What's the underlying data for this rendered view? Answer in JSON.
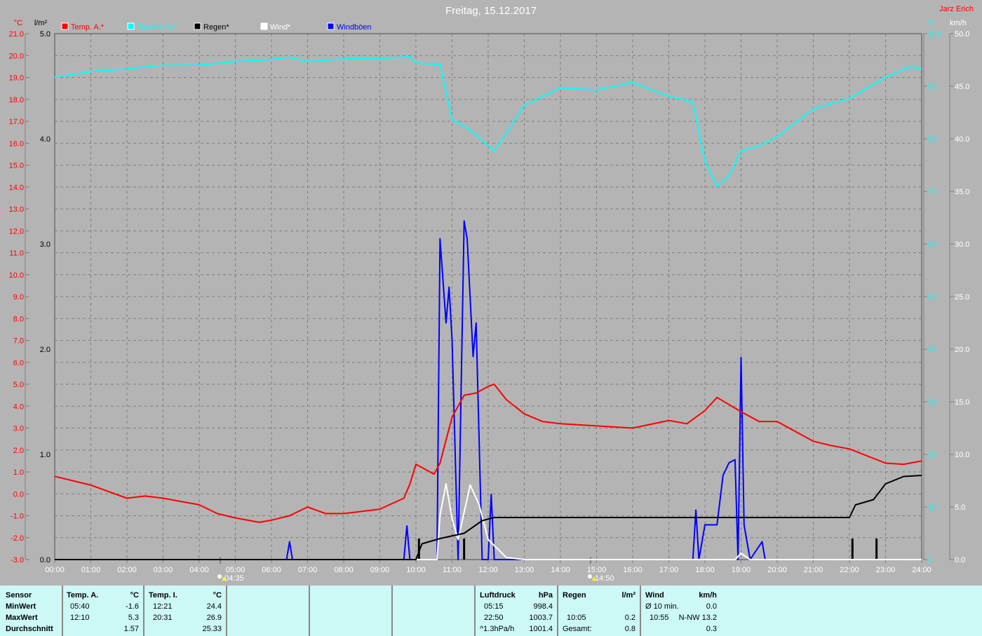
{
  "title": "Freitag, 15.12.2017",
  "author": "Jarz Erich",
  "colors": {
    "background": "#b4b4b4",
    "temp": "#ff0000",
    "humidity": "#00ffff",
    "rain": "#000000",
    "wind": "#ffffff",
    "gusts": "#0000ff",
    "table": "#ccf8f6"
  },
  "chart_data": {
    "type": "line",
    "title": "Freitag, 15.12.2017",
    "legend": {
      "placement": "top",
      "entries": [
        "Temp. A.*",
        "Feuchte A.*",
        "Regen*",
        "Wind*",
        "Windböen"
      ]
    },
    "grid": true,
    "x_ticks": [
      "00:00",
      "01:00",
      "02:00",
      "03:00",
      "04:00",
      "05:00",
      "06:00",
      "07:00",
      "08:00",
      "09:00",
      "10:00",
      "11:00",
      "12:00",
      "13:00",
      "14:00",
      "15:00",
      "16:00",
      "17:00",
      "18:00",
      "19:00",
      "20:00",
      "21:00",
      "22:00",
      "23:00",
      "24:00"
    ],
    "xlim": [
      "00:00",
      "24:00"
    ],
    "axes": {
      "temp": {
        "unit": "°C",
        "ylim": [
          -3,
          21
        ],
        "ticks": [
          "21.0",
          "20.0",
          "19.0",
          "18.0",
          "17.0",
          "16.0",
          "15.0",
          "14.0",
          "13.0",
          "12.0",
          "11.0",
          "10.0",
          "9.0",
          "8.0",
          "7.0",
          "6.0",
          "5.0",
          "4.0",
          "3.0",
          "2.0",
          "1.0",
          "0.0",
          "-1.0",
          "-2.0",
          "-3.0"
        ]
      },
      "rain": {
        "unit": "l/m²",
        "ylim": [
          0,
          5
        ],
        "ticks": [
          "5.0",
          "4.0",
          "3.0",
          "2.0",
          "1.0",
          "0.0"
        ]
      },
      "humidity": {
        "unit": "%",
        "ylim": [
          0,
          100
        ],
        "ticks": [
          "100",
          "90",
          "80",
          "70",
          "60",
          "50",
          "40",
          "30",
          "20",
          "10",
          "0"
        ]
      },
      "wind": {
        "unit": "km/h",
        "ylim": [
          0,
          50
        ],
        "ticks": [
          "50.0",
          "45.0",
          "40.0",
          "35.0",
          "30.0",
          "25.0",
          "20.0",
          "15.0",
          "10.0",
          "5.0",
          "0.0"
        ]
      }
    },
    "sun": {
      "sunrise": "04:35",
      "sunset": "14:50"
    },
    "series": [
      {
        "name": "Temp. A.*",
        "axis": "temp",
        "points": [
          [
            "00:00",
            0.8
          ],
          [
            "01:00",
            0.4
          ],
          [
            "02:00",
            -0.2
          ],
          [
            "02:30",
            -0.1
          ],
          [
            "03:00",
            -0.2
          ],
          [
            "04:00",
            -0.5
          ],
          [
            "04:30",
            -0.9
          ],
          [
            "05:00",
            -1.1
          ],
          [
            "05:40",
            -1.3
          ],
          [
            "06:00",
            -1.2
          ],
          [
            "06:30",
            -1.0
          ],
          [
            "07:00",
            -0.6
          ],
          [
            "07:30",
            -0.9
          ],
          [
            "08:00",
            -0.9
          ],
          [
            "08:30",
            -0.8
          ],
          [
            "09:00",
            -0.7
          ],
          [
            "09:40",
            -0.2
          ],
          [
            "09:50",
            0.45
          ],
          [
            "10:00",
            1.35
          ],
          [
            "10:30",
            0.9
          ],
          [
            "10:40",
            1.4
          ],
          [
            "11:00",
            3.5
          ],
          [
            "11:20",
            4.5
          ],
          [
            "11:40",
            4.6
          ],
          [
            "12:00",
            4.9
          ],
          [
            "12:10",
            5.0
          ],
          [
            "12:30",
            4.3
          ],
          [
            "13:00",
            3.65
          ],
          [
            "13:30",
            3.3
          ],
          [
            "14:00",
            3.2
          ],
          [
            "15:00",
            3.1
          ],
          [
            "16:00",
            3.0
          ],
          [
            "17:00",
            3.35
          ],
          [
            "17:30",
            3.2
          ],
          [
            "18:00",
            3.8
          ],
          [
            "18:20",
            4.4
          ],
          [
            "19:00",
            3.75
          ],
          [
            "19:30",
            3.3
          ],
          [
            "20:00",
            3.3
          ],
          [
            "21:00",
            2.4
          ],
          [
            "21:30",
            2.2
          ],
          [
            "22:00",
            2.05
          ],
          [
            "23:00",
            1.4
          ],
          [
            "23:30",
            1.35
          ],
          [
            "24:00",
            1.5
          ]
        ]
      },
      {
        "name": "Feuchte A.*",
        "axis": "humidity",
        "points": [
          [
            "00:00",
            91.7
          ],
          [
            "01:00",
            92.8
          ],
          [
            "02:00",
            93.3
          ],
          [
            "03:00",
            94.0
          ],
          [
            "04:00",
            94.0
          ],
          [
            "05:00",
            94.7
          ],
          [
            "06:00",
            95.1
          ],
          [
            "06:30",
            95.5
          ],
          [
            "07:00",
            94.7
          ],
          [
            "08:00",
            95.2
          ],
          [
            "09:00",
            95.3
          ],
          [
            "09:50",
            95.6
          ],
          [
            "10:00",
            94.4
          ],
          [
            "10:40",
            94.1
          ],
          [
            "11:00",
            83.7
          ],
          [
            "11:30",
            81.7
          ],
          [
            "12:10",
            77.7
          ],
          [
            "12:30",
            81.0
          ],
          [
            "13:00",
            86.4
          ],
          [
            "14:00",
            89.7
          ],
          [
            "15:00",
            89.3
          ],
          [
            "16:00",
            90.7
          ],
          [
            "17:00",
            88.1
          ],
          [
            "17:40",
            87.0
          ],
          [
            "18:00",
            75.7
          ],
          [
            "18:20",
            71.0
          ],
          [
            "18:40",
            73.0
          ],
          [
            "19:00",
            77.7
          ],
          [
            "19:30",
            78.7
          ],
          [
            "20:00",
            80.4
          ],
          [
            "21:00",
            85.7
          ],
          [
            "22:00",
            87.7
          ],
          [
            "23:00",
            91.7
          ],
          [
            "23:40",
            93.7
          ],
          [
            "24:00",
            93.3
          ]
        ]
      },
      {
        "name": "Regen*",
        "axis": "rain",
        "points": [
          [
            "00:00",
            0
          ],
          [
            "10:00",
            0
          ],
          [
            "10:10",
            0.15
          ],
          [
            "10:40",
            0.2
          ],
          [
            "11:20",
            0.25
          ],
          [
            "11:50",
            0.37
          ],
          [
            "12:10",
            0.4
          ],
          [
            "22:00",
            0.4
          ],
          [
            "22:10",
            0.52
          ],
          [
            "22:40",
            0.57
          ],
          [
            "23:00",
            0.72
          ],
          [
            "23:30",
            0.79
          ],
          [
            "24:00",
            0.8
          ]
        ],
        "bars": [
          [
            "10:05",
            0.2
          ],
          [
            "11:20",
            0.2
          ],
          [
            "22:05",
            0.2
          ],
          [
            "22:45",
            0.2
          ]
        ]
      },
      {
        "name": "Wind*",
        "axis": "wind",
        "points": [
          [
            "00:00",
            0
          ],
          [
            "10:35",
            0
          ],
          [
            "10:40",
            4.2
          ],
          [
            "10:50",
            7.2
          ],
          [
            "11:00",
            3.9
          ],
          [
            "11:10",
            1.9
          ],
          [
            "11:30",
            7.1
          ],
          [
            "11:45",
            5.2
          ],
          [
            "12:00",
            1.9
          ],
          [
            "12:30",
            0.2
          ],
          [
            "13:00",
            0
          ],
          [
            "18:50",
            0
          ],
          [
            "19:00",
            0.6
          ],
          [
            "19:15",
            0
          ],
          [
            "24:00",
            0
          ]
        ]
      },
      {
        "name": "Windböen",
        "axis": "wind",
        "points": [
          [
            "00:00",
            0
          ],
          [
            "06:25",
            0
          ],
          [
            "06:30",
            1.7
          ],
          [
            "06:35",
            0
          ],
          [
            "09:40",
            0
          ],
          [
            "09:45",
            3.2
          ],
          [
            "09:50",
            0
          ],
          [
            "10:35",
            0
          ],
          [
            "10:40",
            30.5
          ],
          [
            "10:50",
            22.5
          ],
          [
            "10:55",
            25.9
          ],
          [
            "11:00",
            20.9
          ],
          [
            "11:10",
            0
          ],
          [
            "11:20",
            32.2
          ],
          [
            "11:25",
            30.5
          ],
          [
            "11:35",
            19.3
          ],
          [
            "11:40",
            22.5
          ],
          [
            "11:50",
            0
          ],
          [
            "12:00",
            0
          ],
          [
            "12:05",
            6.2
          ],
          [
            "12:10",
            0
          ],
          [
            "17:40",
            0
          ],
          [
            "17:45",
            4.7
          ],
          [
            "17:50",
            0
          ],
          [
            "18:00",
            3.3
          ],
          [
            "18:20",
            3.3
          ],
          [
            "18:30",
            8.0
          ],
          [
            "18:40",
            9.2
          ],
          [
            "18:50",
            9.5
          ],
          [
            "18:55",
            0
          ],
          [
            "19:00",
            19.2
          ],
          [
            "19:05",
            3.3
          ],
          [
            "19:15",
            0
          ],
          [
            "19:35",
            1.7
          ],
          [
            "19:40",
            0
          ],
          [
            "24:00",
            0
          ]
        ]
      }
    ]
  },
  "table": {
    "sensor": {
      "header": "Sensor",
      "rows": [
        "MinWert",
        "MaxWert",
        "Durchschnitt"
      ]
    },
    "temp_a": {
      "header": "Temp. A.",
      "unit": "°C",
      "min_time": "05:40",
      "min": "-1.6",
      "max_time": "12:10",
      "max": "5.3",
      "avg": "1.57"
    },
    "temp_i": {
      "header": "Temp. I.",
      "unit": "°C",
      "min_time": "12:21",
      "min": "24.4",
      "max_time": "20:31",
      "max": "26.9",
      "avg": "25.33"
    },
    "pressure": {
      "header": "Luftdruck",
      "unit": "hPa",
      "min_time": "05:15",
      "min": "998.4",
      "max_time": "22:50",
      "max": "1003.7",
      "trend": "^1.3hPa/h",
      "avg": "1001.4"
    },
    "rain": {
      "header": "Regen",
      "unit": "l/m²",
      "max_time": "10:05",
      "max": "0.2",
      "total_label": "Gesamt:",
      "total": "0.8"
    },
    "wind": {
      "header": "Wind",
      "unit": "km/h",
      "avg_label": "Ø 10 min.",
      "avg10": "0.0",
      "max_time": "10:55",
      "max": "N-NW 13.2",
      "avg": "0.3"
    }
  }
}
